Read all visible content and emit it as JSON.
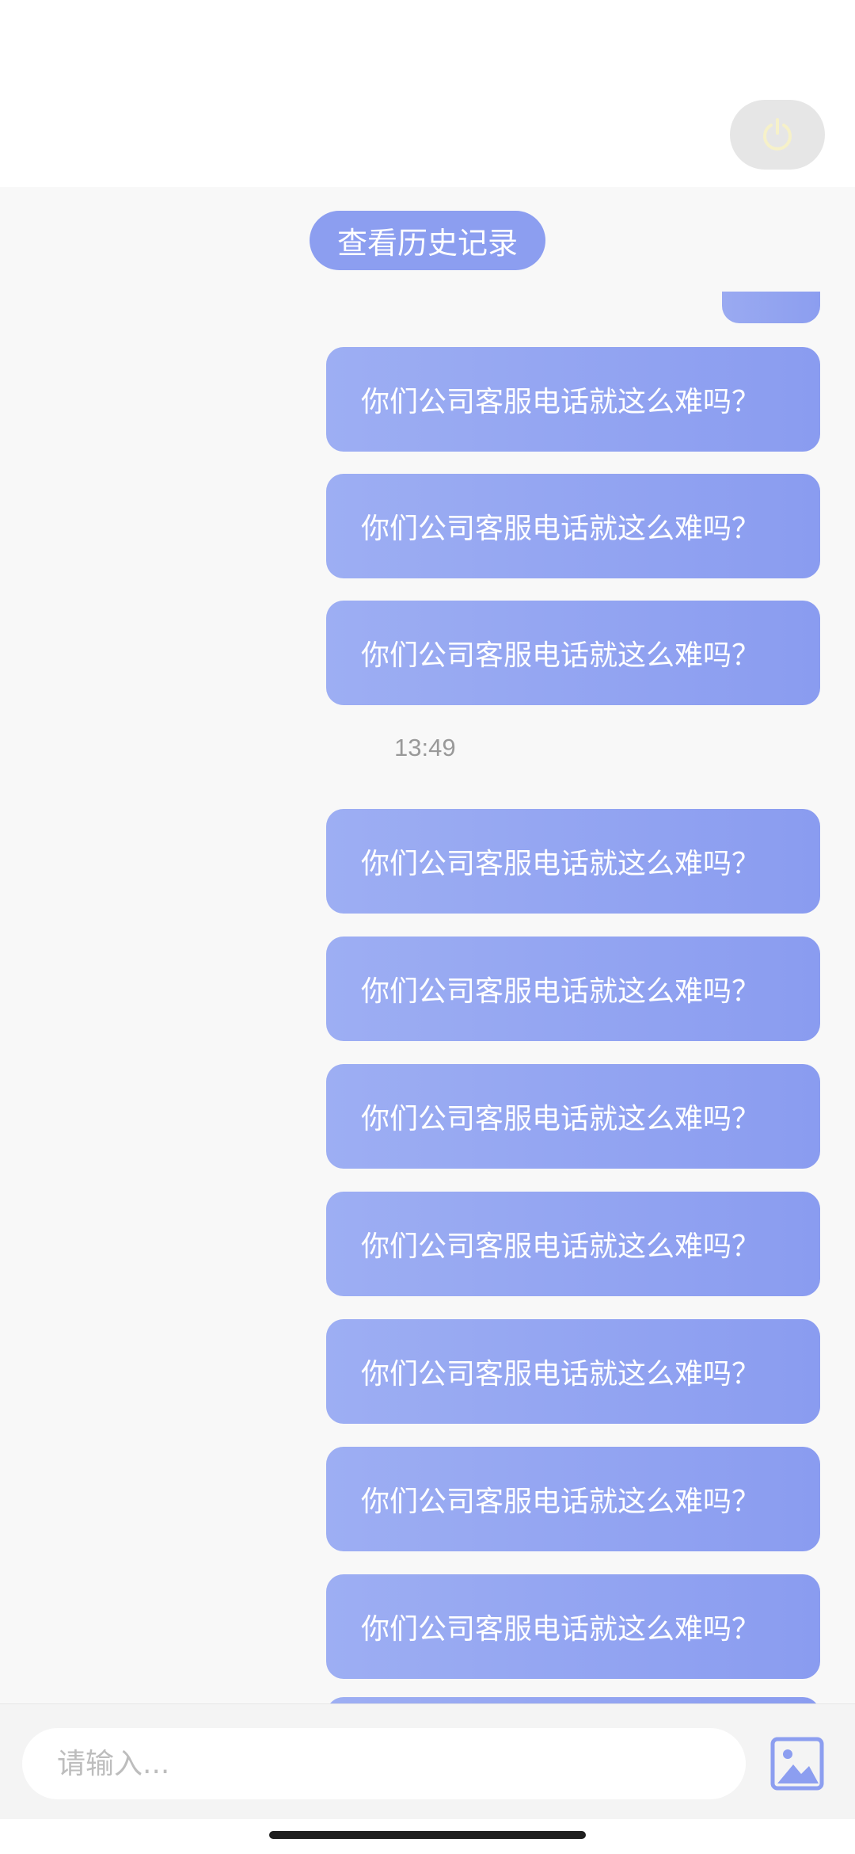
{
  "header": {
    "power_icon": "power-icon"
  },
  "chat": {
    "history_label": "查看历史记录",
    "messages_before_time": [
      "你们公司客服电话就这么难吗？",
      "你们公司客服电话就这么难吗？",
      "你们公司客服电话就这么难吗？"
    ],
    "timestamp": "13:49",
    "messages_after_time": [
      "你们公司客服电话就这么难吗？",
      "你们公司客服电话就这么难吗？",
      "你们公司客服电话就这么难吗？",
      "你们公司客服电话就这么难吗？",
      "你们公司客服电话就这么难吗？",
      "你们公司客服电话就这么难吗？",
      "你们公司客服电话就这么难吗？"
    ]
  },
  "composer": {
    "placeholder": "请输入...",
    "value": "",
    "image_icon": "image-icon"
  },
  "colors": {
    "bubble_start": "#9daef3",
    "bubble_end": "#8a9cf0",
    "history_pill": "#8c9ef0",
    "power_button_bg": "#e6e6e6",
    "power_icon": "#f6f1c9",
    "chat_bg": "#f8f8f8",
    "image_icon": "#8c9ef0"
  }
}
